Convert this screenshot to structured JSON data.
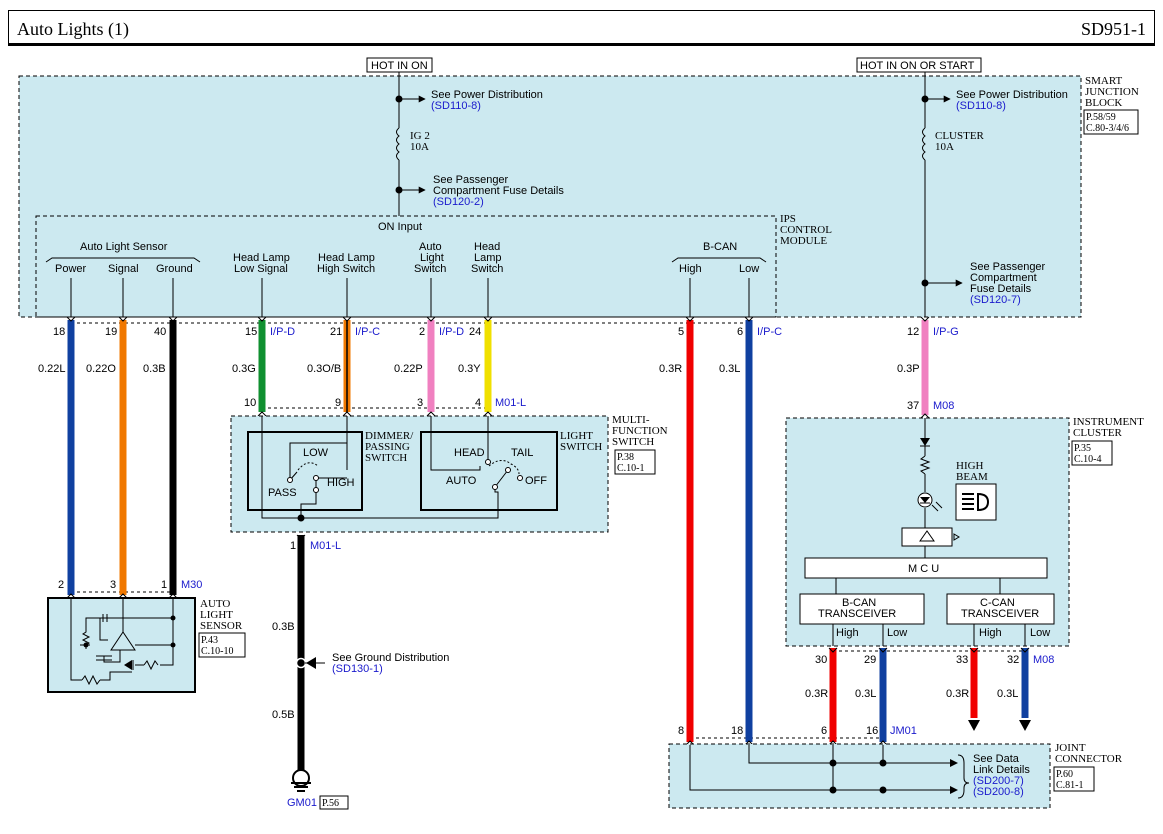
{
  "header": {
    "title": "Auto Lights (1)",
    "code": "SD951-1"
  },
  "power": {
    "hot_on": "HOT IN ON",
    "hot_on_start": "HOT IN ON OR START",
    "see_power": "See Power Distribution",
    "power_ref": "(SD110-8)",
    "fuse_ig_name": "IG 2",
    "fuse_ig_amp": "10A",
    "fuse_cl_name": "CLUSTER",
    "fuse_cl_amp": "10A",
    "see_pass_l1": "See Passenger",
    "see_pass_l2": "Compartment Fuse Details",
    "pass_ref_1": "(SD120-2)",
    "see_pass2_l1": "See Passenger",
    "see_pass2_l2": "Compartment",
    "see_pass2_l3": "Fuse Details",
    "pass_ref_2": "(SD120-7)"
  },
  "sjb": {
    "l1": "SMART",
    "l2": "JUNCTION",
    "l3": "BLOCK",
    "p1": "P.58/59",
    "p2": "C.80-3/4/6"
  },
  "ips": {
    "l1": "IPS",
    "l2": "CONTROL",
    "l3": "MODULE",
    "on_input": "ON Input",
    "auto_light_sensor": "Auto Light Sensor",
    "power": "Power",
    "signal": "Signal",
    "ground": "Ground",
    "hl_low_1": "Head Lamp",
    "hl_low_2": "Low Signal",
    "hl_high_1": "Head Lamp",
    "hl_high_2": "High Switch",
    "auto_sw_1": "Auto",
    "auto_sw_2": "Light",
    "auto_sw_3": "Switch",
    "head_sw_1": "Head",
    "head_sw_2": "Lamp",
    "head_sw_3": "Switch",
    "bcan": "B-CAN",
    "high": "High",
    "low": "Low"
  },
  "wires": {
    "p18": "18",
    "p19": "19",
    "p40": "40",
    "p15": "15",
    "p21": "21",
    "p2": "2",
    "p24": "24",
    "p5": "5",
    "p6": "6",
    "p12": "12",
    "c_ipd1": "I/P-D",
    "c_ipc1": "I/P-C",
    "c_ipd2": "I/P-D",
    "c_ipc2": "I/P-C",
    "c_ipg": "I/P-G",
    "w022l": "0.22L",
    "w022o": "0.22O",
    "w03b": "0.3B",
    "w03g": "0.3G",
    "w03ob": "0.3O/B",
    "w022p": "0.22P",
    "w03y": "0.3Y",
    "w03r": "0.3R",
    "w03l": "0.3L",
    "w03p": "0.3P",
    "m10": "10",
    "m9": "9",
    "m3": "3",
    "m4": "4",
    "m01l": "M01-L",
    "gnd_pin": "1",
    "gnd_conn": "M01-L",
    "gnd_w1": "0.3B",
    "gnd_w2": "0.5B",
    "see_ground": "See Ground Distribution",
    "ground_ref": "(SD130-1)",
    "gm01": "GM01",
    "gm01_page": "P.56",
    "s2": "2",
    "s3": "3",
    "s1": "1",
    "m30": "M30",
    "c37": "37",
    "m08": "M08",
    "c30": "30",
    "c29": "29",
    "c33": "33",
    "c32": "32",
    "m08b": "M08",
    "w03r_b": "0.3R",
    "w03l_b": "0.3L",
    "w03r_c": "0.3R",
    "w03l_c": "0.3L",
    "j8": "8",
    "j18": "18",
    "j6": "6",
    "j16": "16",
    "jm01": "JM01"
  },
  "mfs": {
    "l1": "MULTI-",
    "l2": "FUNCTION",
    "l3": "SWITCH",
    "p1": "P.38",
    "p2": "C.10-1",
    "dim_1": "DIMMER/",
    "dim_2": "PASSING",
    "dim_3": "SWITCH",
    "low": "LOW",
    "pass": "PASS",
    "high": "HIGH",
    "ls_1": "LIGHT",
    "ls_2": "SWITCH",
    "head": "HEAD",
    "tail": "TAIL",
    "auto": "AUTO",
    "off": "OFF"
  },
  "als": {
    "l1": "AUTO",
    "l2": "LIGHT",
    "l3": "SENSOR",
    "p1": "P.43",
    "p2": "C.10-10"
  },
  "cluster": {
    "l1": "INSTRUMENT",
    "l2": "CLUSTER",
    "p1": "P.35",
    "p2": "C.10-4",
    "hb_1": "HIGH",
    "hb_2": "BEAM",
    "mcu": "M C U",
    "bcan_1": "B-CAN",
    "bcan_2": "TRANSCEIVER",
    "ccan_1": "C-CAN",
    "ccan_2": "TRANSCEIVER",
    "high1": "High",
    "low1": "Low",
    "high2": "High",
    "low2": "Low"
  },
  "joint": {
    "l1": "JOINT",
    "l2": "CONNECTOR",
    "p1": "P.60",
    "p2": "C.81-1",
    "see_1": "See Data",
    "see_2": "Link Details",
    "ref1": "(SD200-7)",
    "ref2": "(SD200-8)"
  },
  "colors": {
    "wire_blue": "#1040a0",
    "wire_orange": "#f07800",
    "wire_black": "#000000",
    "wire_green": "#109030",
    "wire_pink": "#f080c0",
    "wire_yellow": "#f0e000",
    "wire_red": "#f00000",
    "box_fill": "#cce9f0",
    "link": "#1a1acc"
  },
  "icons": [
    "ground-symbol-icon",
    "high-beam-icon",
    "led-icon",
    "fuse-icon",
    "arrow-icon"
  ]
}
